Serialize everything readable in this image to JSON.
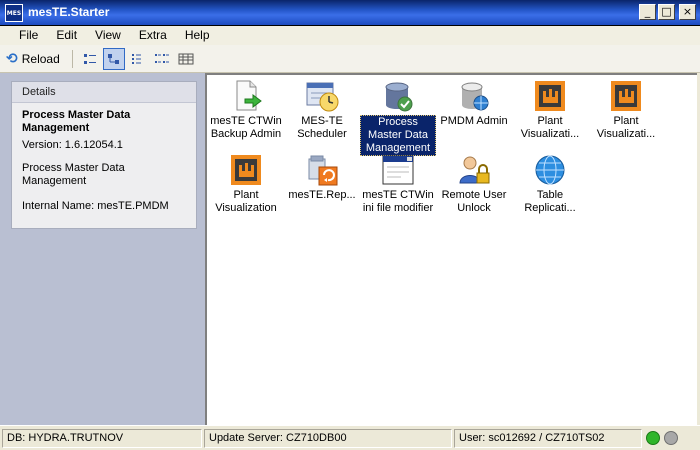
{
  "window": {
    "title": "mesTE.Starter",
    "app_icon_text": "MES",
    "btn_min": "_",
    "btn_max": "□",
    "btn_close": "×"
  },
  "menu": [
    "File",
    "Edit",
    "View",
    "Extra",
    "Help"
  ],
  "toolbar": {
    "reload_label": "Reload"
  },
  "details": {
    "header": "Details",
    "name": "Process Master Data Management",
    "version": "Version: 1.6.12054.1",
    "description": "Process Master Data Management",
    "internal_name": "Internal Name: mesTE.PMDM"
  },
  "apps": [
    {
      "label": "mesTE CTWin Backup Admin",
      "icon": "document-arrow-icon"
    },
    {
      "label": "MES-TE Scheduler",
      "icon": "scheduler-clock-icon"
    },
    {
      "label": "Process Master Data Management",
      "icon": "database-check-icon",
      "selected": true
    },
    {
      "label": "PMDM Admin",
      "icon": "database-globe-icon"
    },
    {
      "label": "Plant Visualizati...",
      "icon": "plant-visualization-icon"
    },
    {
      "label": "Plant Visualizati...",
      "icon": "plant-visualization-icon"
    },
    {
      "label": "Plant Visualization",
      "icon": "plant-visualization-icon"
    },
    {
      "label": "mesTE.Rep...",
      "icon": "recycle-report-icon"
    },
    {
      "label": "mesTE CTWin ini file modifier",
      "icon": "window-editor-icon"
    },
    {
      "label": "Remote User Unlock",
      "icon": "user-lock-icon"
    },
    {
      "label": "Table Replicati...",
      "icon": "globe-icon"
    }
  ],
  "status": {
    "db": "DB: HYDRA.TRUTNOV",
    "update_server": "Update Server: CZ710DB00",
    "user": "User: sc012692 / CZ710TS02",
    "led_green": "#2fb52a",
    "led_gray": "#a8a8a8"
  }
}
